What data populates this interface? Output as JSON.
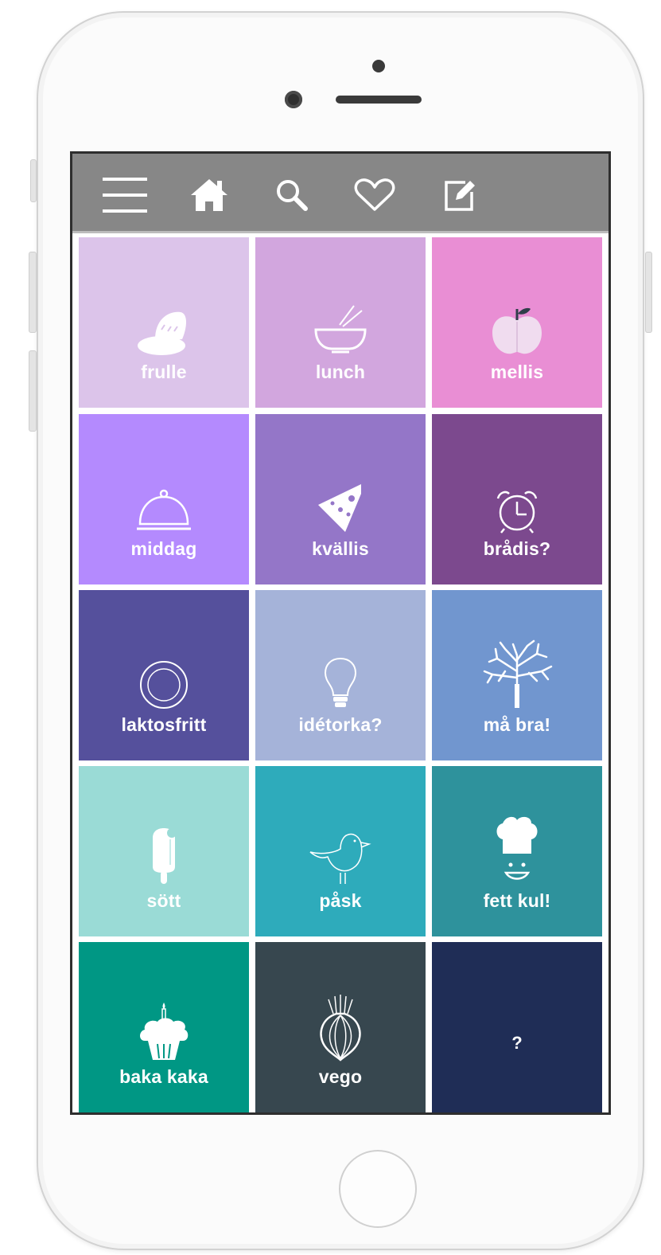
{
  "nav": {
    "icons": [
      "menu-icon",
      "home-icon",
      "search-icon",
      "heart-icon",
      "edit-icon"
    ]
  },
  "tiles": [
    {
      "label": "frulle",
      "icon": "bread-icon",
      "color": "#dcc4ea"
    },
    {
      "label": "lunch",
      "icon": "bowl-icon",
      "color": "#d2a6de"
    },
    {
      "label": "mellis",
      "icon": "apple-icon",
      "color": "#e98ed4"
    },
    {
      "label": "middag",
      "icon": "cloche-icon",
      "color": "#b48afe"
    },
    {
      "label": "kvällis",
      "icon": "cheese-icon",
      "color": "#9476c8"
    },
    {
      "label": "brådis?",
      "icon": "alarm-clock-icon",
      "color": "#7c498e"
    },
    {
      "label": "laktosfritt",
      "icon": "plate-icon",
      "color": "#55509c"
    },
    {
      "label": "idétorka?",
      "icon": "lightbulb-icon",
      "color": "#a5b3d9"
    },
    {
      "label": "må bra!",
      "icon": "tree-icon",
      "color": "#7196cf"
    },
    {
      "label": "sött",
      "icon": "ice-cream-icon",
      "color": "#9adbd6"
    },
    {
      "label": "påsk",
      "icon": "bird-icon",
      "color": "#2eabbb"
    },
    {
      "label": "fett kul!",
      "icon": "chef-icon",
      "color": "#2e929c"
    },
    {
      "label": "baka kaka",
      "icon": "cupcake-icon",
      "color": "#009784"
    },
    {
      "label": "vego",
      "icon": "onion-icon",
      "color": "#37474f"
    },
    {
      "label": "?",
      "icon": "",
      "color": "#1f2d56"
    }
  ]
}
